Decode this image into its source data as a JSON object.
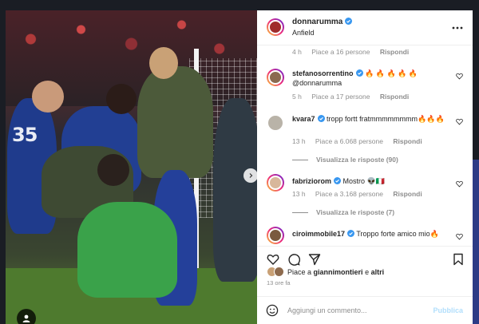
{
  "post": {
    "username": "donnarumma",
    "location": "Anfield",
    "likes_avatars": [
      "#c9a176",
      "#8e6b4e"
    ],
    "liked_by_prefix": "Piace a",
    "liked_by_user": "giannimontieri",
    "liked_by_suffix_and": "e",
    "liked_by_others": "altri",
    "time_ago": "13 ore fa"
  },
  "comments": [
    {
      "user": "",
      "text": "",
      "time": "4 h",
      "likes": "Piace a 16 persone",
      "reply": "Rispondi"
    },
    {
      "user": "stefanosorrentino",
      "text": "🔥 🔥 🔥 🔥 🔥",
      "mention": "@donnarumma",
      "time": "5 h",
      "likes": "Piace a 17 persone",
      "reply": "Rispondi",
      "avatar_color": "#8b6a50"
    },
    {
      "user": "kvara7",
      "text": "tropp fortt fratmmmmmmmm🔥🔥🔥",
      "time": "13 h",
      "likes": "Piace a 6.068 persone",
      "reply": "Rispondi",
      "view_replies": "Visualizza le risposte (90)",
      "avatar_color": "#b9b3a8"
    },
    {
      "user": "fabriziorom",
      "text": "Mostro 👽🇮🇹",
      "time": "13 h",
      "likes": "Piace a 3.168 persone",
      "reply": "Rispondi",
      "view_replies": "Visualizza le risposte (7)",
      "avatar_color": "#d8b79b"
    },
    {
      "user": "ciroimmobile17",
      "text": "Troppo forte amico mio🔥",
      "avatar_color": "#7a5a3f"
    }
  ],
  "photo": {
    "jersey_number": "35"
  },
  "composer": {
    "placeholder": "Aggiungi un commento...",
    "publish_label": "Pubblica"
  },
  "icons": {
    "more": "more-icon",
    "heart": "heart-icon",
    "comment": "comment-icon",
    "share": "share-icon",
    "save": "bookmark-icon",
    "emoji": "emoji-icon",
    "verified": "verified-badge-icon"
  },
  "colors": {
    "verified": "#3897f0",
    "publish_disabled": "#b2dffc"
  }
}
